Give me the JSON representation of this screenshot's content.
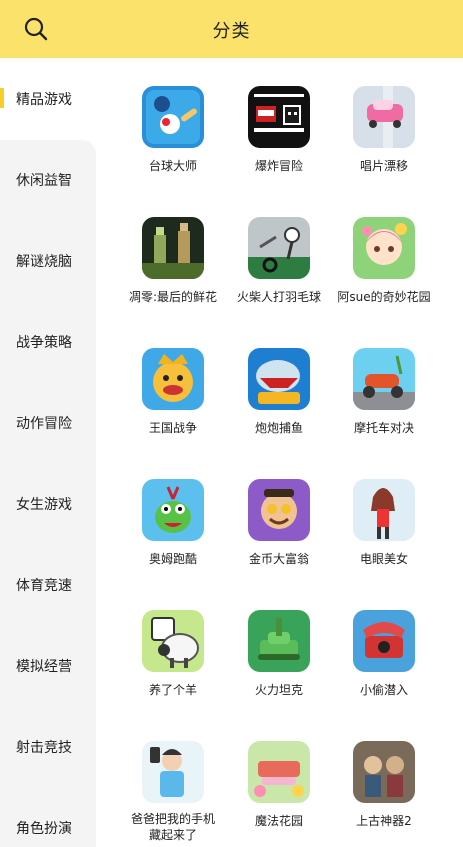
{
  "header": {
    "title": "分类"
  },
  "sidebar": {
    "categories": [
      {
        "label": "精品游戏",
        "active": true
      },
      {
        "label": "休闲益智"
      },
      {
        "label": "解谜烧脑"
      },
      {
        "label": "战争策略"
      },
      {
        "label": "动作冒险"
      },
      {
        "label": "女生游戏"
      },
      {
        "label": "体育竞速"
      },
      {
        "label": "模拟经营"
      },
      {
        "label": "射击竞技"
      },
      {
        "label": "角色扮演"
      }
    ]
  },
  "games": [
    {
      "name": "台球大师",
      "icon": "billiards-icon"
    },
    {
      "name": "爆炸冒险",
      "icon": "tnt-pixel-icon"
    },
    {
      "name": "唱片漂移",
      "icon": "pink-car-icon"
    },
    {
      "name": "凋零:最后的鲜花",
      "icon": "pixel-zombie-icon"
    },
    {
      "name": "火柴人打羽毛球",
      "icon": "stickman-badminton-icon"
    },
    {
      "name": "阿sue的奇妙花园",
      "icon": "flower-girl-icon"
    },
    {
      "name": "王国战争",
      "icon": "king-face-icon"
    },
    {
      "name": "炮炮捕鱼",
      "icon": "shark-icon"
    },
    {
      "name": "摩托车对决",
      "icon": "scooter-icon"
    },
    {
      "name": "奥姆跑酷",
      "icon": "om-nom-icon"
    },
    {
      "name": "金币大富翁",
      "icon": "rich-man-icon"
    },
    {
      "name": "电眼美女",
      "icon": "girl-icon"
    },
    {
      "name": "养了个羊",
      "icon": "sheep-icon"
    },
    {
      "name": "火力坦克",
      "icon": "tank-icon"
    },
    {
      "name": "小偷潜入",
      "icon": "red-phone-icon"
    },
    {
      "name": "爸爸把我的手机藏起来了",
      "icon": "dad-phone-icon",
      "two_line": true
    },
    {
      "name": "魔法花园",
      "icon": "garden-bloom-icon"
    },
    {
      "name": "上古神器2",
      "icon": "ancient-artifact-icon"
    }
  ],
  "colors": {
    "header_bg": "#fbe36b",
    "active_indicator": "#f7cf2a",
    "sidebar_bg": "#f4f4f4"
  }
}
